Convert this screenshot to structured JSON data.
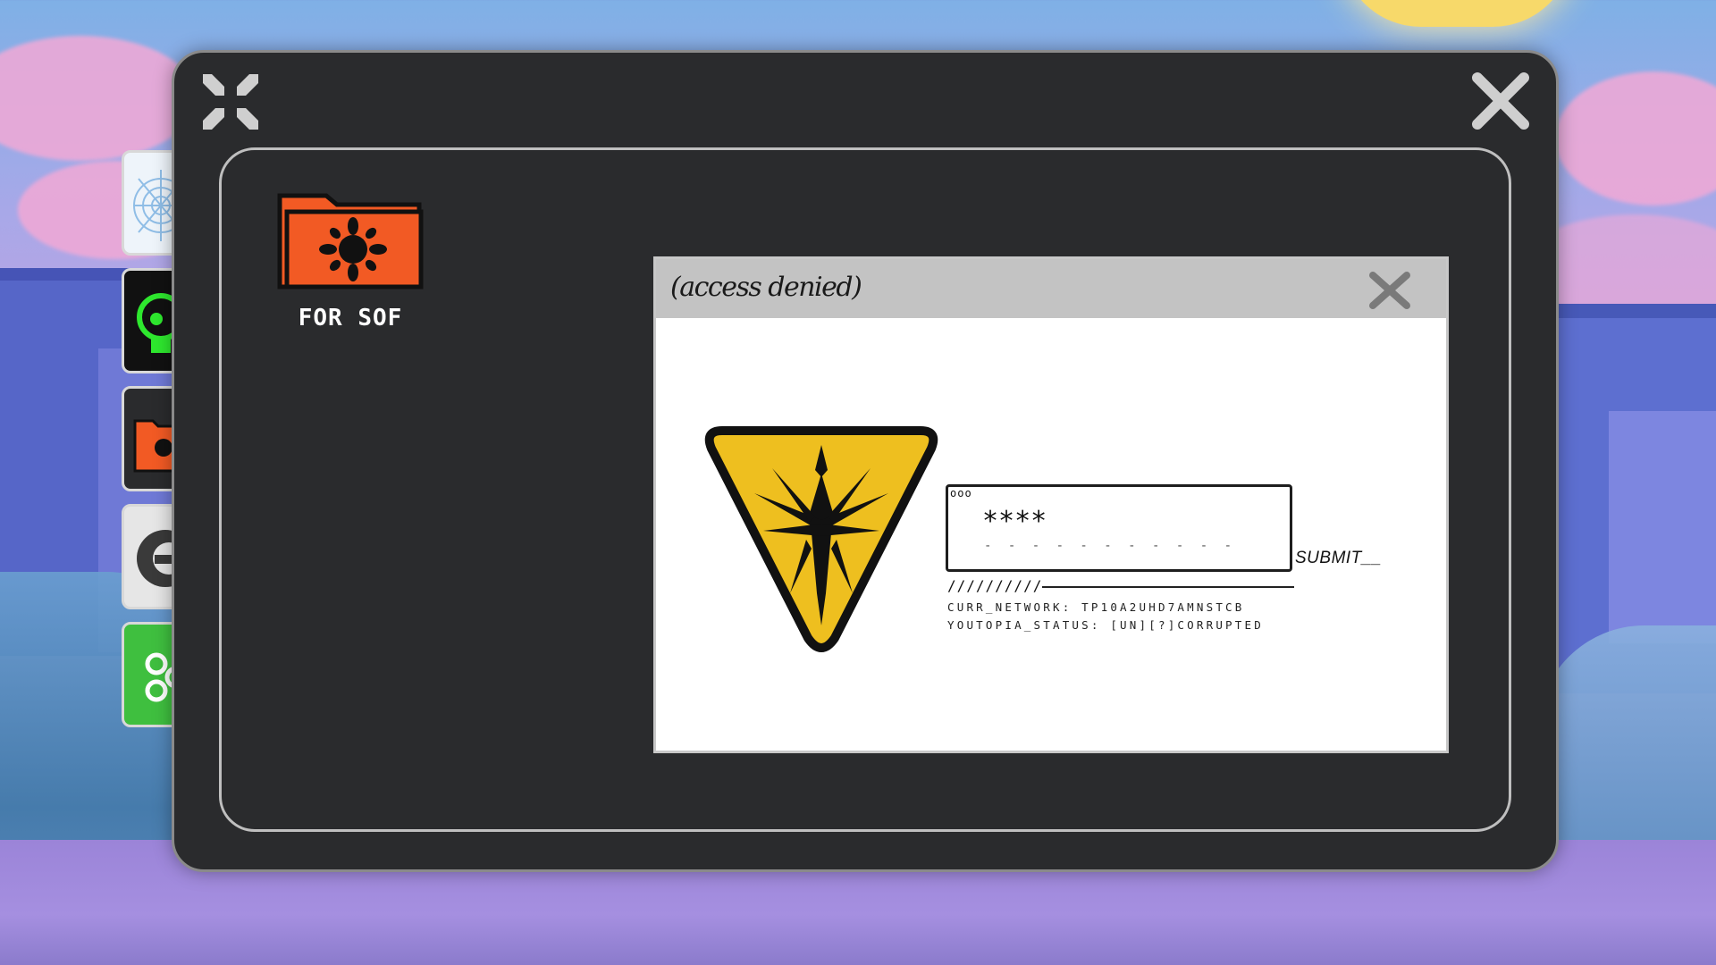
{
  "colors": {
    "window_bg": "#2a2b2d",
    "folder_orange": "#f25a24",
    "warning_yellow": "#eebf1f",
    "dialog_titlebar": "#c3c3c3"
  },
  "window": {
    "minimize_icon": "compress-arrows-icon",
    "close_icon": "close-x-icon"
  },
  "dock": {
    "items": [
      {
        "icon": "spiderweb-icon",
        "color": "#cfe4f5"
      },
      {
        "icon": "green-skull-icon",
        "color": "#111111"
      },
      {
        "icon": "orange-folder-icon",
        "color": "#f25a24"
      },
      {
        "icon": "grey-helmet-icon",
        "color": "#e6e6e6"
      },
      {
        "icon": "green-bio-icon",
        "color": "#3fbf3f"
      }
    ]
  },
  "folder": {
    "label": "FOR SOF",
    "icon": "orange-folder-sigil-icon"
  },
  "dialog": {
    "title": "(access denied)",
    "close_icon": "close-x-icon",
    "warning_icon": "yellow-warning-triangle-icon",
    "box_dots": "ooo",
    "password_value": "****",
    "underline": "- - - - - - - - - - - - - - - - -",
    "submit_label": "SUBMIT__",
    "slashes": "//////////",
    "network_line": "CURR_NETWORK: TP10A2UHD7AMNSTCB",
    "status_line": "YOUTOPIA_STATUS: [UN][?]CORRUPTED"
  }
}
